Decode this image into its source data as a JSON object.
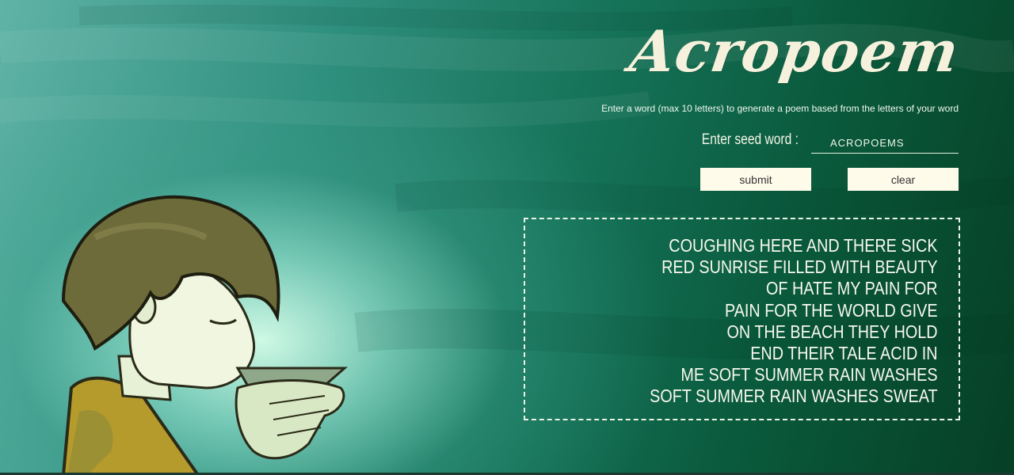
{
  "app": {
    "title": "Acropoem",
    "instructions": "Enter a word (max 10 letters) to generate a poem based from the letters of your word"
  },
  "form": {
    "seed_label": "Enter seed word :",
    "seed_value": "ACROPOEMS",
    "submit_label": "submit",
    "clear_label": "clear"
  },
  "poem": {
    "lines": [
      "COUGHING HERE AND THERE SICK",
      "RED SUNRISE FILLED WITH BEAUTY",
      "OF HATE MY PAIN FOR",
      "PAIN FOR THE WORLD GIVE",
      "ON THE BEACH THEY HOLD",
      "END THEIR TALE ACID IN",
      "ME SOFT SUMMER RAIN WASHES",
      "SOFT SUMMER RAIN WASHES SWEAT"
    ]
  },
  "colors": {
    "accent_text": "#f6f1dc",
    "button_bg": "#fffbea",
    "background_dark": "#063f24",
    "background_light": "#5fb3a6"
  },
  "background_illustration": "boy-drinking-from-cupped-hands"
}
